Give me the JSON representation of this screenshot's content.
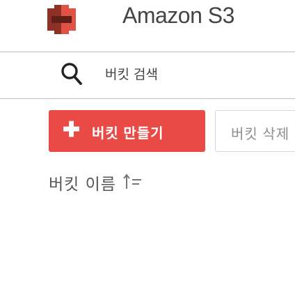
{
  "header": {
    "logo_icon": "amazon-s3-bucket-icon",
    "title": "Amazon S3"
  },
  "search": {
    "icon": "search-icon",
    "placeholder": "버킷 검색"
  },
  "toolbar": {
    "create_icon": "plus-icon",
    "create_label": "버킷 만들기",
    "settings_label": "버킷 삭제"
  },
  "table": {
    "column_header": "버킷 이름",
    "sort_icon": "sort-icon"
  },
  "colors": {
    "accent": "#ea4a45",
    "logo_dark": "#8c3123",
    "logo_light": "#e05243"
  }
}
